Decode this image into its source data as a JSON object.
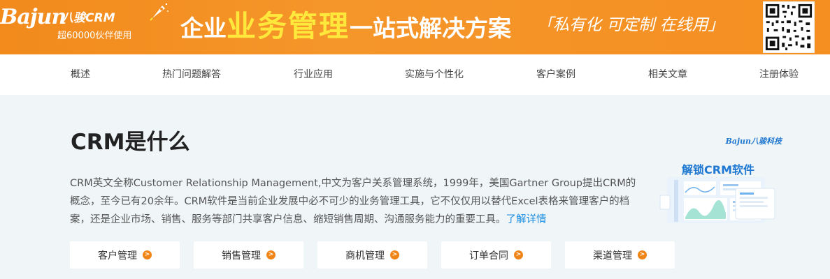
{
  "banner": {
    "logo_text": "Bajun",
    "logo_cn": "八骏CRM",
    "logo_sub": "超60000伙伴使用",
    "headline_a": "企业",
    "headline_b": "业务管理",
    "headline_c": "一站式解决方案",
    "slogan": "「私有化 可定制 在线用」"
  },
  "nav": {
    "items": [
      {
        "label": "概述"
      },
      {
        "label": "热门问题解答"
      },
      {
        "label": "行业应用"
      },
      {
        "label": "实施与个性化"
      },
      {
        "label": "客户案例"
      },
      {
        "label": "相关文章"
      },
      {
        "label": "注册体验"
      }
    ]
  },
  "main": {
    "title": "CRM是什么",
    "description": "CRM英文全称Customer Relationship Management,中文为客户关系管理系统，1999年，美国Gartner Group提出CRM的概念，至今已有20余年。CRM软件是当前企业发展中必不可少的业务管理工具，它不仅仅用以替代Excel表格来管理客户的档案，还是企业市场、销售、服务等部门共享客户信息、缩短销售周期、沟通服务能力的重要工具。",
    "more_link": "了解详情"
  },
  "promo": {
    "logo": "Bajun八骏科技",
    "title": "解锁CRM软件"
  },
  "tiles": [
    {
      "label": "客户管理"
    },
    {
      "label": "销售管理"
    },
    {
      "label": "商机管理"
    },
    {
      "label": "订单合同"
    },
    {
      "label": "渠道管理"
    }
  ],
  "colors": {
    "banner_orange": "#f28a1c",
    "headline_yellow": "#ffe83c",
    "link_blue": "#1f8fe0",
    "arrow_orange": "#f08417"
  }
}
